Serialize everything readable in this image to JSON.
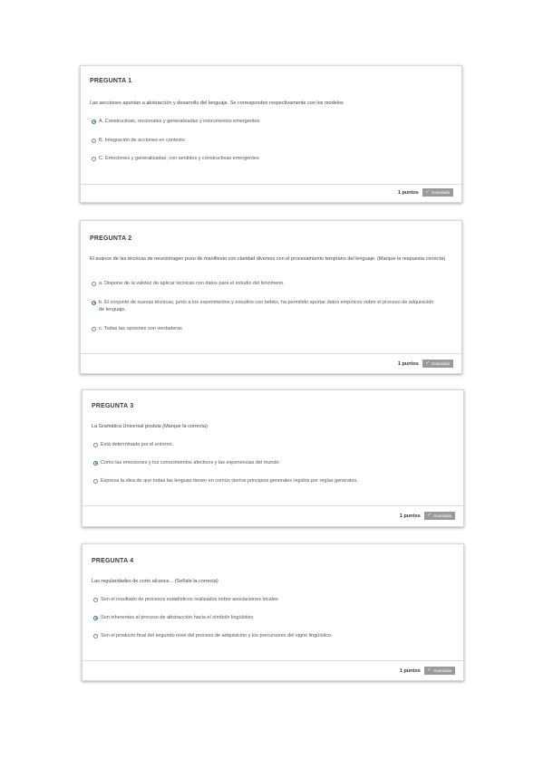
{
  "questions": [
    {
      "header": "PREGUNTA 1",
      "text": "Las secciones apuntan a abstracción y desarrollo del lenguaje. Se corresponden respectivamente con los modelos",
      "options": [
        {
          "label": "A. Constructivas, nocionales y generalizadas y instrumentos emergentes",
          "checked": true
        },
        {
          "label": "B. Integración de acciones en contexto",
          "checked": false
        },
        {
          "label": "C. Emociones y generalizadas, con sentidos y constructivas emergentes",
          "checked": false
        }
      ],
      "points": "1 puntos",
      "status": "Guardada"
    },
    {
      "header": "PREGUNTA 2",
      "text": "El avance de las técnicas de neuroimagen puso de manifiesto con claridad diversos con el procesamiento temprano del lenguaje. (Marque la respuesta correcta)",
      "options": [
        {
          "label": "a. Dispone de la validez de aplicar técnicas con datos para el estudio del fenómeno.",
          "checked": false
        },
        {
          "label": "b. El conjunto de nuevas técnicas, junto a los experimentos y estudios con bebés, ha permitido aportar datos empíricos sobre el proceso de adquisición de lenguaje.",
          "checked": true
        },
        {
          "label": "c. Todas las opciones son verdaderas",
          "checked": false
        }
      ],
      "points": "1 puntos",
      "status": "Guardada"
    },
    {
      "header": "PREGUNTA 3",
      "text": "La Gramática Universal postula (Marque la correcta)",
      "options": [
        {
          "label": "Está determinada por el entorno.",
          "checked": false
        },
        {
          "label": "Como las emociones y los conocimientos afectivos y las experiencias del mundo.",
          "checked": true
        },
        {
          "label": "Expresa la idea de que todas las lenguas tienen en común ciertos principios generales regidos por reglas generales.",
          "checked": false
        }
      ],
      "points": "1 puntos",
      "status": "Guardada"
    },
    {
      "header": "PREGUNTA 4",
      "text": "Las regularidades de corto alcance... (Señale la correcta)",
      "options": [
        {
          "label": "Son el resultado de procesos estadísticos realizados sobre asociaciones locales",
          "checked": false
        },
        {
          "label": "Son inherentes al proceso de abstracción hacia el símbolo lingüístico",
          "checked": true
        },
        {
          "label": "Son el producto final del segundo nivel del proceso de adquisición y los precursores del signo lingüístico.",
          "checked": false
        }
      ],
      "points": "1 puntos",
      "status": "Guardada"
    }
  ],
  "colors": {
    "radio_checked": "#2d6fb7",
    "badge_bg": "#9a9a9a",
    "check": "#d9f0c0"
  },
  "icons": {
    "status_icon": "check-icon"
  }
}
